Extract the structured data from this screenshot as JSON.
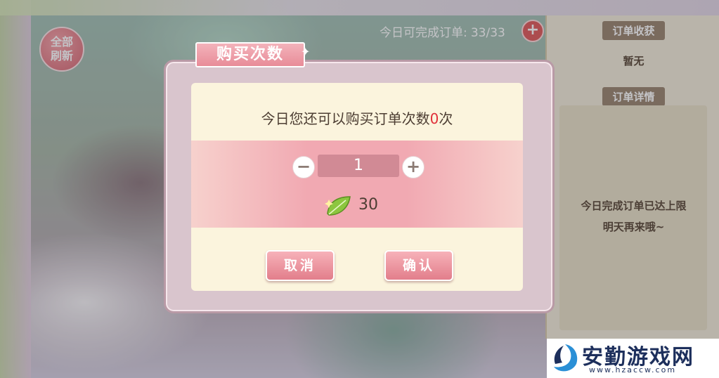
{
  "background": {
    "refresh_label_line1": "全部",
    "refresh_label_line2": "刷新",
    "order_count_label": "今日可完成订单:",
    "order_count_value": "33/33",
    "add_icon": "plus-icon"
  },
  "right_panel": {
    "section1_title": "订单收获",
    "section1_value": "暂无",
    "section2_title": "订单详情",
    "detail_line1": "今日完成订单已达上限",
    "detail_line2": "明天再来哦~"
  },
  "dialog": {
    "title": "购买次数",
    "message_prefix": "今日您还可以购买订单次数",
    "message_count": "0",
    "message_suffix": "次",
    "quantity": "1",
    "minus_symbol": "−",
    "plus_symbol": "+",
    "price": "30",
    "price_icon": "leaf-icon",
    "cancel_label": "取消",
    "confirm_label": "确认"
  },
  "watermark": {
    "title": "安勤游戏网",
    "url": "www.hzaccw.com"
  },
  "colors": {
    "accent_pink": "#e88c98",
    "highlight_red": "#e0303a",
    "panel_cream": "#fbf4dd"
  }
}
